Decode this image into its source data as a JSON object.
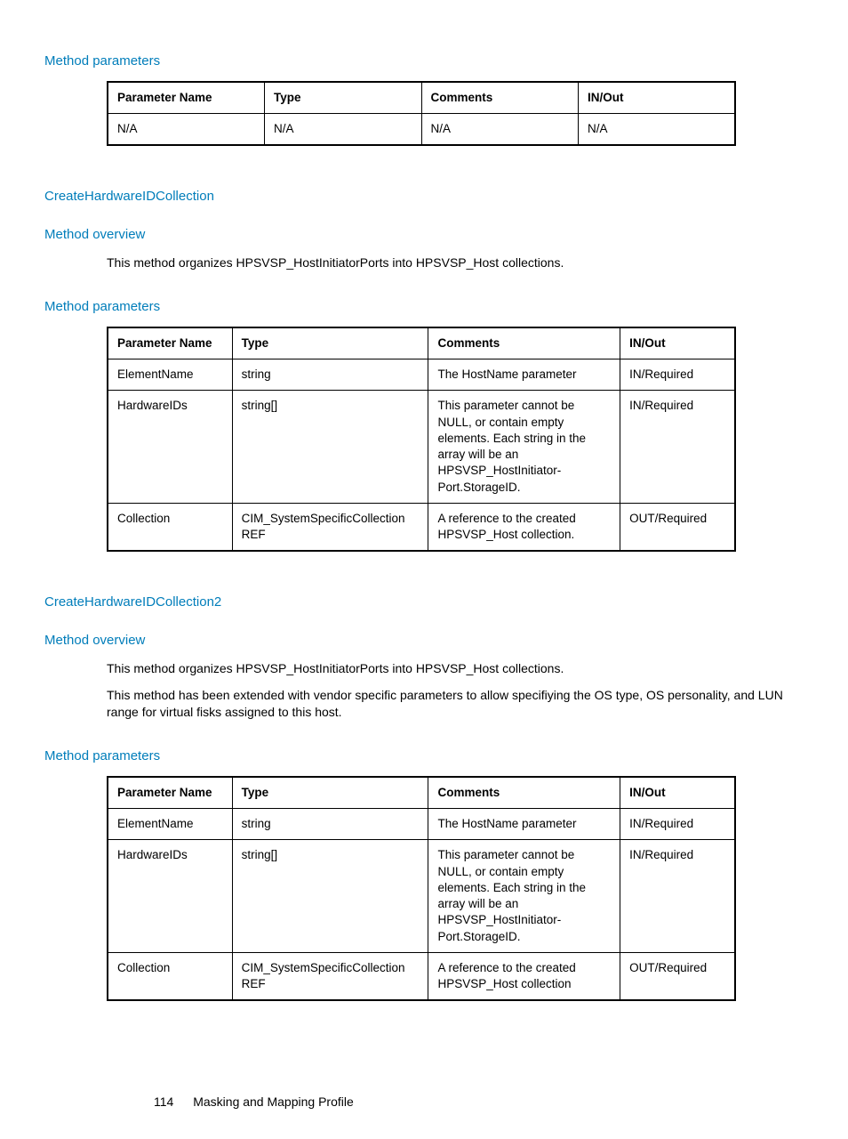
{
  "section1": {
    "heading": "Method parameters",
    "table": {
      "headers": [
        "Parameter Name",
        "Type",
        "Comments",
        "IN/Out"
      ],
      "rows": [
        {
          "c1": "N/A",
          "c2": "N/A",
          "c3": "N/A",
          "c4": "N/A"
        }
      ]
    }
  },
  "section2": {
    "title": "CreateHardwareIDCollection",
    "overview_heading": "Method overview",
    "overview_body": "This method organizes HPSVSP_HostInitiatorPorts into HPSVSP_Host collections.",
    "params_heading": "Method parameters",
    "table": {
      "headers": [
        "Parameter Name",
        "Type",
        "Comments",
        "IN/Out"
      ],
      "rows": [
        {
          "c1": "ElementName",
          "c2": "string",
          "c3": "The HostName parameter",
          "c4": "IN/Required"
        },
        {
          "c1": "HardwareIDs",
          "c2": "string[]",
          "c3": "This parameter cannot be NULL, or contain empty elements. Each string in the array will be an HPSVSP_HostInitiator-Port.StorageID.",
          "c4": "IN/Required"
        },
        {
          "c1": "Collection",
          "c2": "CIM_SystemSpecificCollection REF",
          "c3": "A reference to the created HPSVSP_Host collection.",
          "c4": "OUT/Required"
        }
      ]
    }
  },
  "section3": {
    "title": "CreateHardwareIDCollection2",
    "overview_heading": "Method overview",
    "overview_body1": "This method organizes HPSVSP_HostInitiatorPorts into HPSVSP_Host collections.",
    "overview_body2": "This method has been extended with vendor specific parameters to allow specifiying the OS type, OS personality, and LUN range for virtual fisks assigned to this host.",
    "params_heading": "Method parameters",
    "table": {
      "headers": [
        "Parameter Name",
        "Type",
        "Comments",
        "IN/Out"
      ],
      "rows": [
        {
          "c1": "ElementName",
          "c2": "string",
          "c3": "The HostName parameter",
          "c4": "IN/Required"
        },
        {
          "c1": "HardwareIDs",
          "c2": "string[]",
          "c3": "This parameter cannot be NULL, or contain empty elements. Each string in the array will be an HPSVSP_HostInitiator-Port.StorageID.",
          "c4": "IN/Required"
        },
        {
          "c1": "Collection",
          "c2": "CIM_SystemSpecificCollection REF",
          "c3": "A reference to the created HPSVSP_Host collection",
          "c4": "OUT/Required"
        }
      ]
    }
  },
  "footer": {
    "page": "114",
    "title": "Masking and Mapping Profile"
  }
}
